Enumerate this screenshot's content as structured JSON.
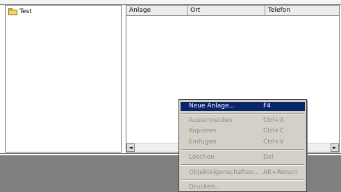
{
  "tree": {
    "items": [
      {
        "label": "Test",
        "icon": "folder-icon"
      }
    ]
  },
  "list": {
    "columns": [
      "Anlage",
      "Ort",
      "Telefon"
    ],
    "scroll": {
      "left_arrow": "◄",
      "right_arrow": "►"
    }
  },
  "context_menu": {
    "items": [
      {
        "label": "Neue Anlage...",
        "shortcut": "F4",
        "state": "active"
      },
      {
        "label": "Ausschneiden",
        "shortcut": "Ctrl+X",
        "state": "disabled"
      },
      {
        "label": "Kopieren",
        "shortcut": "Ctrl+C",
        "state": "disabled"
      },
      {
        "label": "Einfügen",
        "shortcut": "Ctrl+V",
        "state": "disabled"
      },
      {
        "label": "Löschen",
        "shortcut": "Del",
        "state": "disabled"
      },
      {
        "label": "Objekteigenschaften...",
        "shortcut": "Alt+Return",
        "state": "disabled"
      },
      {
        "label": "Drucken...",
        "shortcut": "",
        "state": "disabled"
      }
    ]
  },
  "colors": {
    "highlight": "#0a246a",
    "menu_bg": "#d4d0c8",
    "disabled_text": "#8e8a86",
    "bottom_area": "#808080"
  }
}
